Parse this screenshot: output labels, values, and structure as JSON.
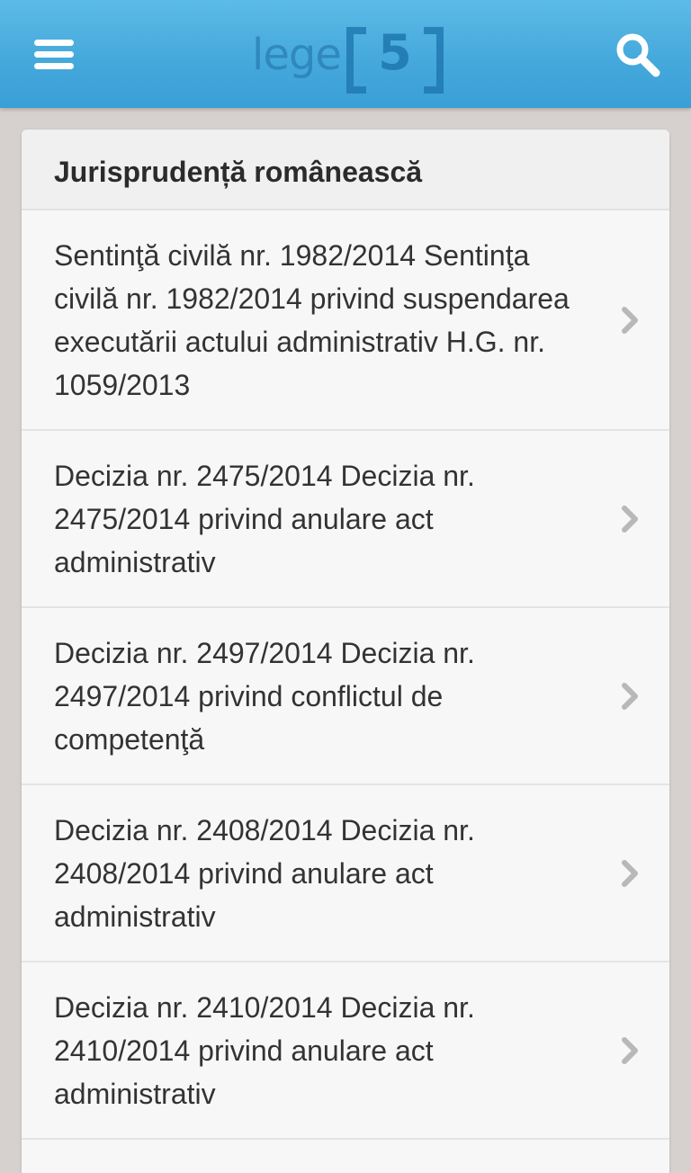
{
  "header": {
    "logo_text": "lege",
    "logo_number": "5"
  },
  "section": {
    "title": "Jurisprudență românească"
  },
  "items": [
    {
      "label": "Sentinţă civilă nr. 1982/2014 Sentinţa civilă nr. 1982/2014 privind suspendarea executării actului administrativ H.G. nr. 1059/2013"
    },
    {
      "label": "Decizia nr. 2475/2014 Decizia nr. 2475/2014 privind anulare act administrativ"
    },
    {
      "label": "Decizia nr. 2497/2014 Decizia nr. 2497/2014 privind conflictul de competenţă"
    },
    {
      "label": "Decizia nr. 2408/2014 Decizia nr. 2408/2014 privind anulare act administrativ"
    },
    {
      "label": "Decizia nr. 2410/2014 Decizia nr. 2410/2014 privind anulare act administrativ"
    }
  ],
  "colors": {
    "topbar": "#45a9dc",
    "background": "#d6d1cf",
    "card": "#f7f7f7"
  },
  "icons": {
    "menu": "hamburger-menu-icon",
    "search": "search-icon",
    "item_arrow": "chevron-right-icon"
  }
}
